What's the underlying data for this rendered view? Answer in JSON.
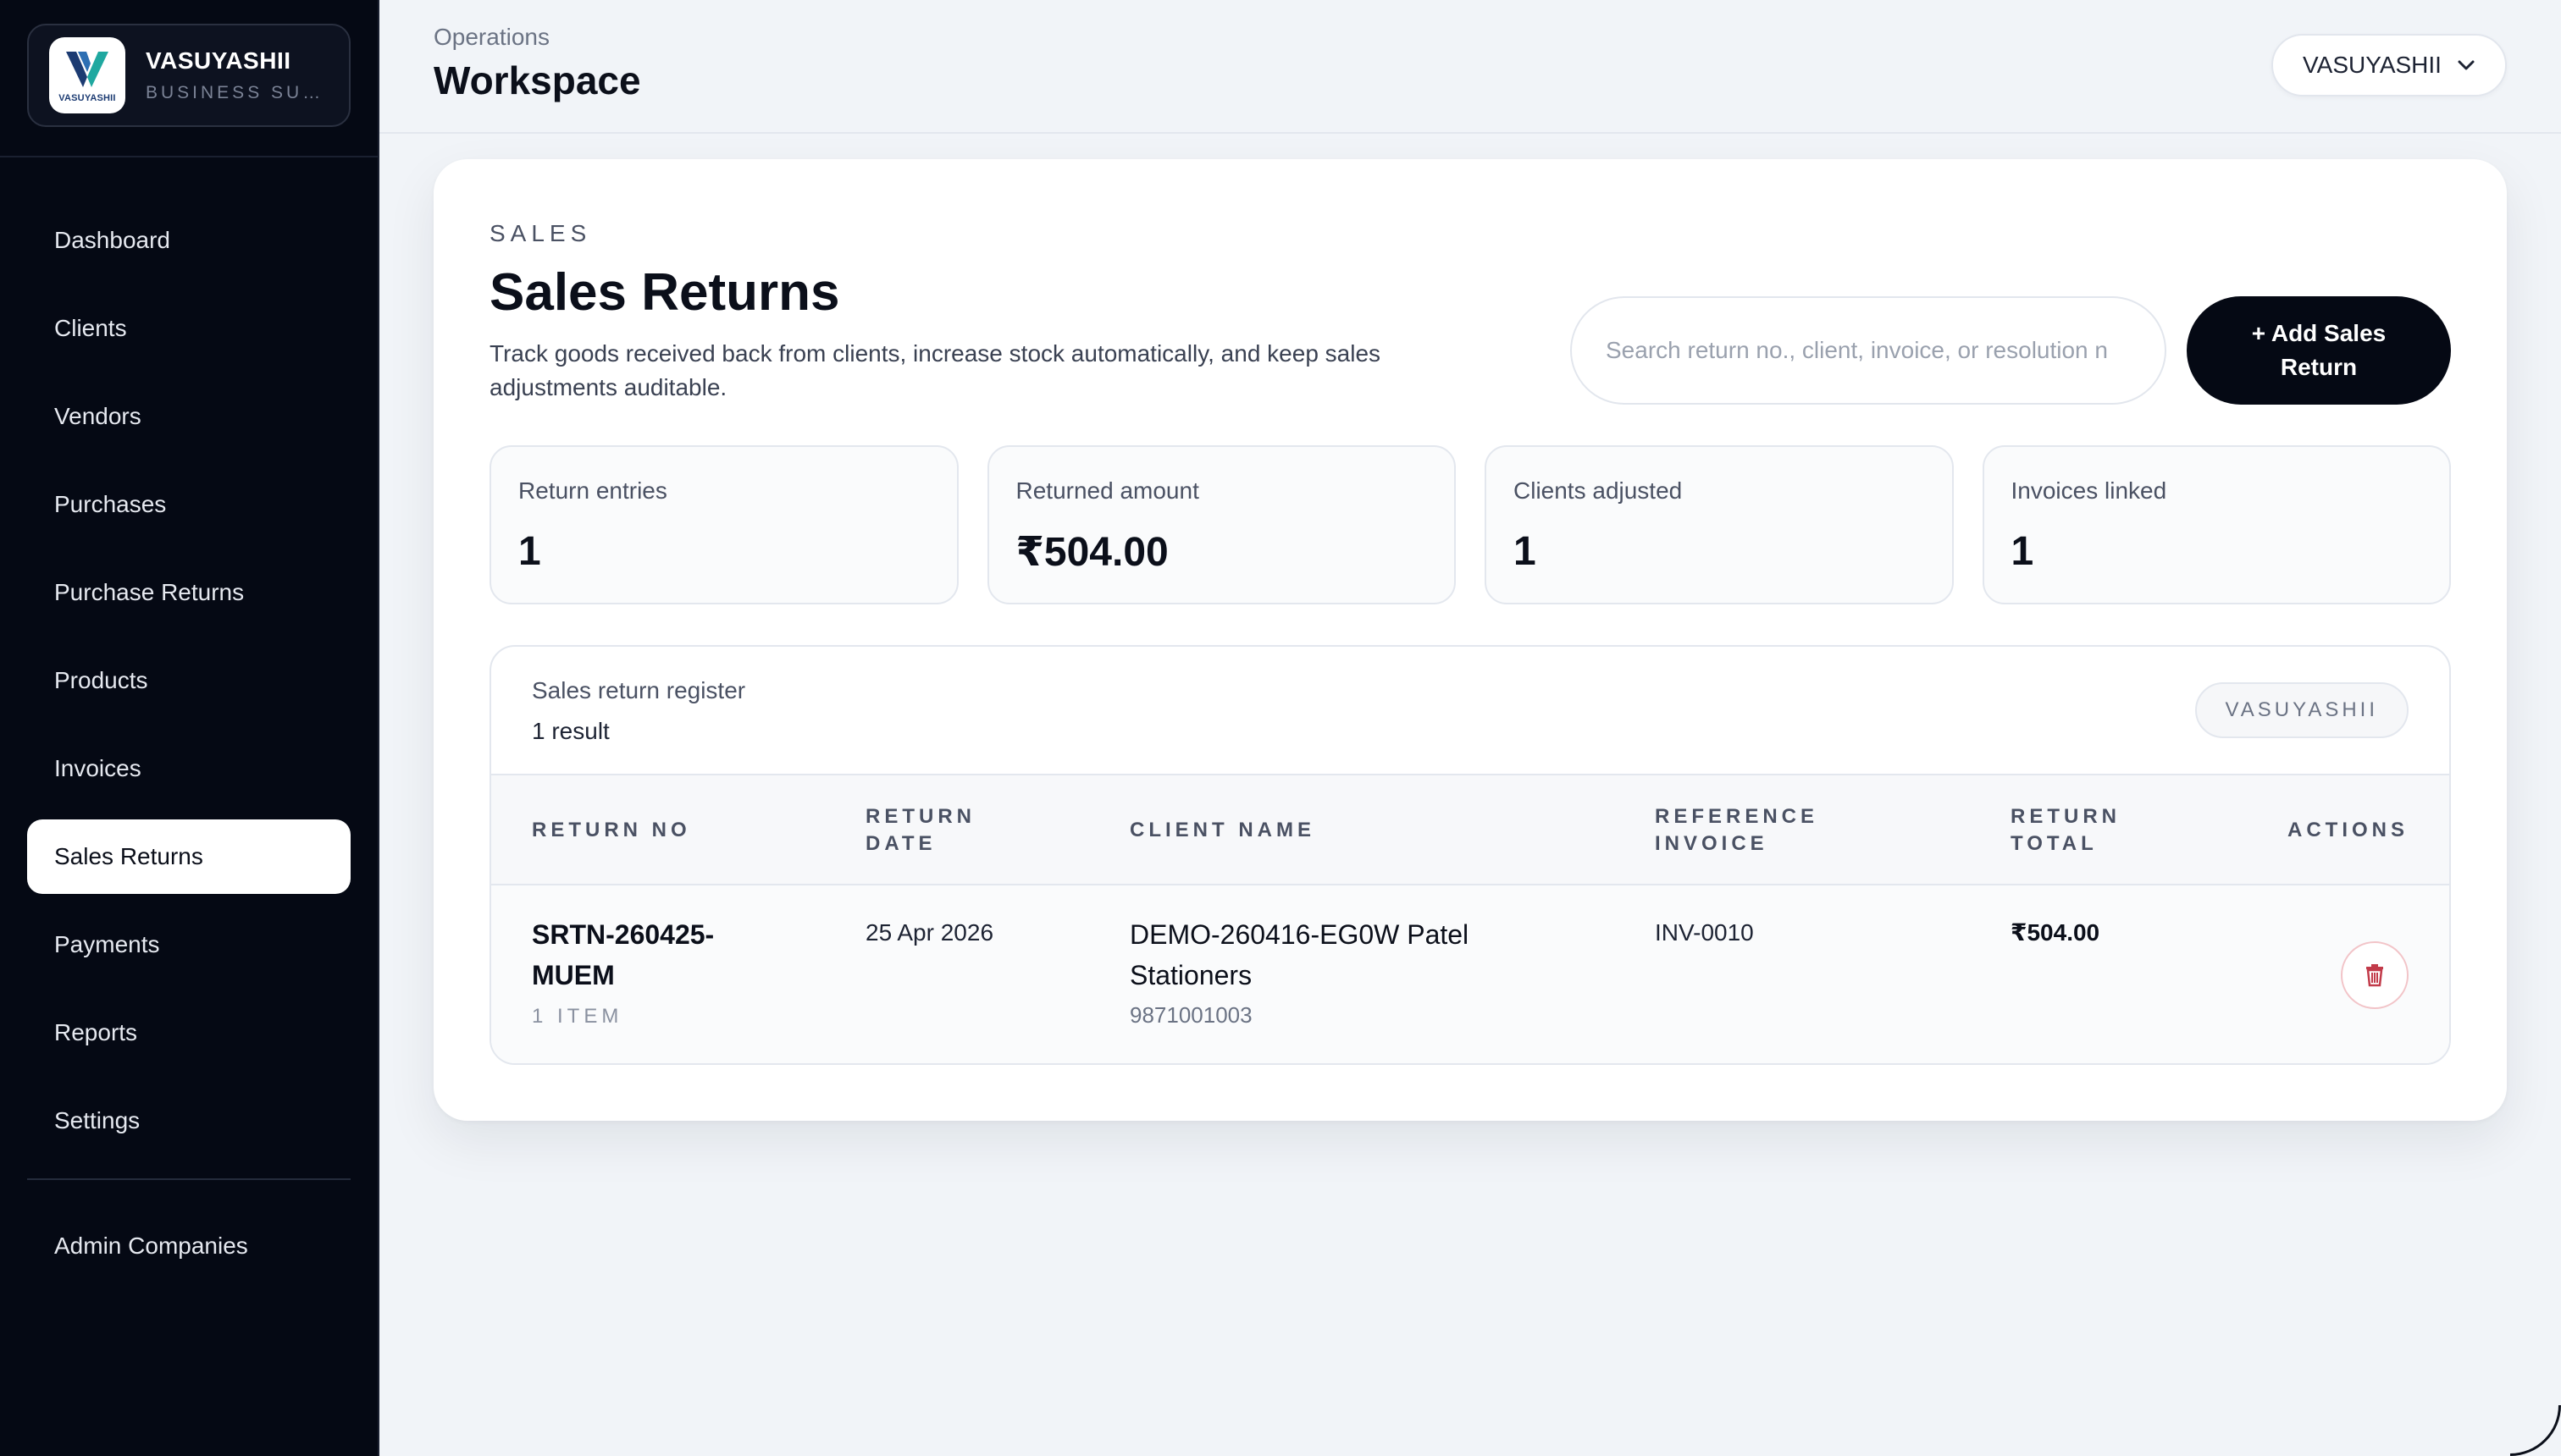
{
  "brand": {
    "name": "VASUYASHII",
    "subtitle": "BUSINESS SUITE",
    "logo_text": "VASUYASHII"
  },
  "nav": {
    "items": [
      {
        "label": "Dashboard"
      },
      {
        "label": "Clients"
      },
      {
        "label": "Vendors"
      },
      {
        "label": "Purchases"
      },
      {
        "label": "Purchase Returns"
      },
      {
        "label": "Products"
      },
      {
        "label": "Invoices"
      },
      {
        "label": "Sales Returns",
        "active": true
      },
      {
        "label": "Payments"
      },
      {
        "label": "Reports"
      },
      {
        "label": "Settings"
      }
    ],
    "admin": {
      "label": "Admin Companies"
    }
  },
  "header": {
    "crumb": "Operations",
    "title": "Workspace",
    "company": "VASUYASHII"
  },
  "section": {
    "eyebrow": "SALES",
    "title": "Sales Returns",
    "description": "Track goods received back from clients, increase stock automatically, and keep sales adjustments auditable.",
    "search_placeholder": "Search return no., client, invoice, or resolution n",
    "add_label": "+ Add Sales Return"
  },
  "stats": [
    {
      "label": "Return entries",
      "value": "1"
    },
    {
      "label": "Returned amount",
      "value": "₹504.00"
    },
    {
      "label": "Clients adjusted",
      "value": "1"
    },
    {
      "label": "Invoices linked",
      "value": "1"
    }
  ],
  "register": {
    "title": "Sales return register",
    "count": "1 result",
    "chip": "VASUYASHII",
    "columns": {
      "return_no": "RETURN NO",
      "return_date": "RETURN DATE",
      "client_name": "CLIENT NAME",
      "reference_invoice": "REFERENCE INVOICE",
      "return_total": "RETURN TOTAL",
      "actions": "ACTIONS"
    },
    "rows": [
      {
        "return_no": "SRTN-260425-MUEM",
        "items": "1 ITEM",
        "return_date": "25 Apr 2026",
        "client_name": "DEMO-260416-EG0W Patel Stationers",
        "client_phone": "9871001003",
        "reference_invoice": "INV-0010",
        "return_total": "₹504.00"
      }
    ]
  },
  "colors": {
    "sidebar_bg": "#050914",
    "accent_dark": "#050914",
    "danger": "#c23b4a",
    "page_bg": "#f1f4f8"
  }
}
